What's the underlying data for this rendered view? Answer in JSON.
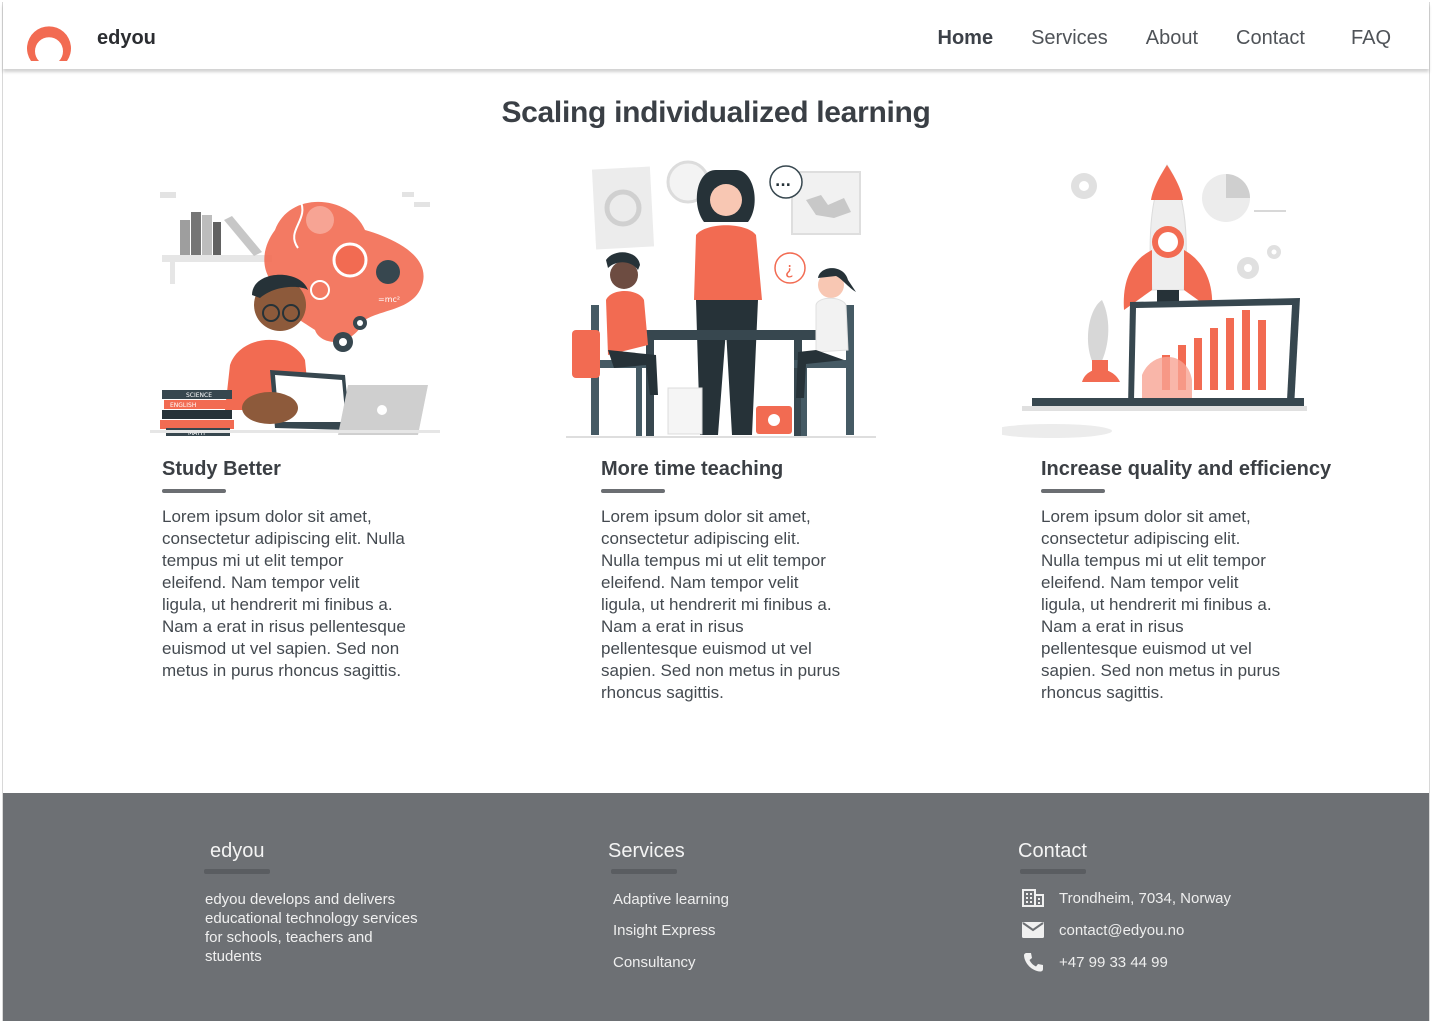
{
  "header": {
    "brand": "edyou",
    "nav": [
      "Home",
      "Services",
      "About",
      "Contact",
      "FAQ"
    ],
    "active": "Home"
  },
  "main": {
    "title": "Scaling individualized learning",
    "cards": [
      {
        "title": "Study Better",
        "body": "Lorem ipsum dolor sit amet, consectetur adipiscing elit. Nulla tempus mi ut elit tempor eleifend. Nam tempor velit ligula, ut hendrerit mi finibus a. Nam a erat in risus pellentesque euismod ut vel sapien. Sed non metus in purus rhoncus sagittis."
      },
      {
        "title": "More time teaching",
        "body": "Lorem ipsum dolor sit amet, consectetur adipiscing elit. Nulla tempus mi ut elit tempor eleifend. Nam tempor velit ligula, ut hendrerit mi finibus a. Nam a erat in risus pellentesque euismod ut vel sapien. Sed non metus in purus rhoncus sagittis."
      },
      {
        "title": "Increase quality and efficiency",
        "body": "Lorem ipsum dolor sit amet, consectetur adipiscing elit. Nulla tempus mi ut elit tempor eleifend. Nam tempor velit ligula, ut hendrerit mi finibus a. Nam a erat in risus pellentesque euismod ut vel sapien. Sed non metus in purus rhoncus sagittis."
      }
    ],
    "illustration_text": {
      "books": [
        "SCIENCE",
        "ENGLISH",
        "MATH"
      ],
      "formula": "=mc²",
      "bubble": "...",
      "question": "¿"
    }
  },
  "footer": {
    "about": {
      "title": "edyou",
      "text": "edyou develops and delivers educational technology services for schools, teachers and students"
    },
    "services": {
      "title": "Services",
      "items": [
        "Adaptive learning",
        "Insight Express",
        "Consultancy"
      ]
    },
    "contact": {
      "title": "Contact",
      "address": "Trondheim, 7034, Norway",
      "email": "contact@edyou.no",
      "phone": "+47 99 33 44 99"
    }
  },
  "colors": {
    "accent": "#f26b52",
    "dark": "#37474f",
    "footer_bg": "#6d7074",
    "text": "#3b3f44"
  },
  "icons": [
    "logo-ring",
    "building-icon",
    "mail-icon",
    "phone-icon"
  ]
}
